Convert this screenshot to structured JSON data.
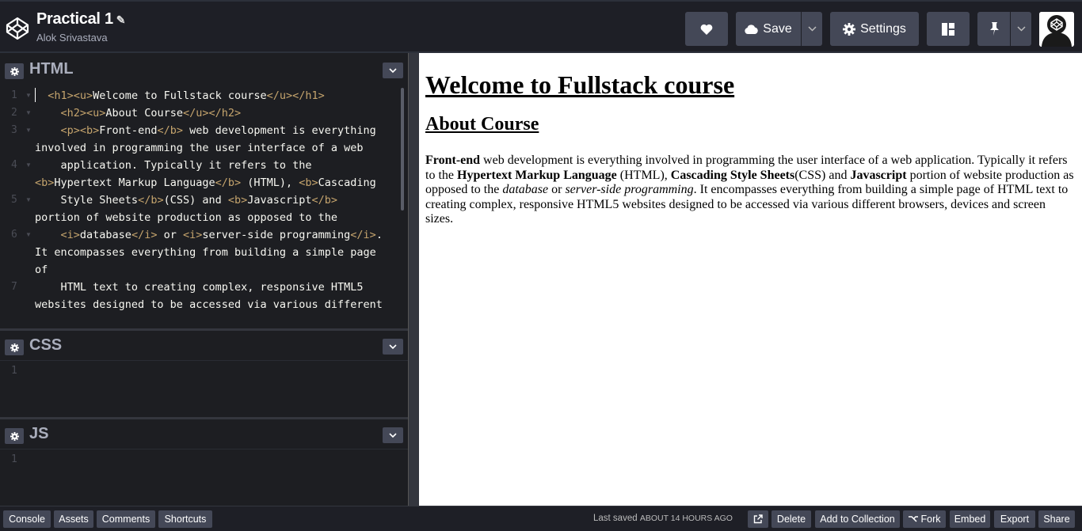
{
  "header": {
    "title": "Practical 1",
    "author": "Alok Srivastava",
    "save_label": "Save",
    "settings_label": "Settings"
  },
  "panels": {
    "html": {
      "title": "HTML",
      "line_numbers": [
        "1",
        "2",
        "3",
        "4",
        "5",
        "6",
        "7"
      ]
    },
    "css": {
      "title": "CSS",
      "line_numbers": [
        "1"
      ]
    },
    "js": {
      "title": "JS",
      "line_numbers": [
        "1"
      ]
    }
  },
  "preview": {
    "heading1": "Welcome to Fullstack course",
    "heading2": "About Course",
    "para": {
      "b1": "Front-end",
      "t1": " web development is everything involved in programming the user interface of a web application. Typically it refers to the ",
      "b2": "Hypertext Markup Language",
      "t2": " (HTML), ",
      "b3": "Cascading Style Sheets",
      "t3": "(CSS) and ",
      "b4": "Javascript",
      "t4": " portion of website production as opposed to the ",
      "i1": "database",
      "t5": " or ",
      "i2": "server-side programming",
      "t6": ". It encompasses everything from building a simple page of HTML text to creating complex, responsive HTML5 websites designed to be accessed via various different browsers, devices and screen sizes."
    }
  },
  "code": {
    "l1a": "<h1><u>",
    "l1b": "Welcome to Fullstack course",
    "l1c": "</u></h1>",
    "l2a": "<h2><u>",
    "l2b": "About Course",
    "l2c": "</u></h2>",
    "l3a": "<p><b>",
    "l3b": "Front-end",
    "l3c": "</b>",
    "l3d": " web development is everything involved in programming the user interface of a web",
    "l4a": "application. Typically it refers to the ",
    "l4b": "<b>",
    "l4c": "Hypertext Markup Language",
    "l4d": "</b>",
    "l4e": " (HTML), ",
    "l4f": "<b>",
    "l4g": "Cascading",
    "l5a": "Style Sheets",
    "l5b": "</b>",
    "l5c": "(CSS) and ",
    "l5d": "<b>",
    "l5e": "Javascript",
    "l5f": "</b>",
    "l5g": " portion of website production as opposed to the",
    "l6a": "<i>",
    "l6b": "database",
    "l6c": "</i>",
    "l6d": " or ",
    "l6e": "<i>",
    "l6f": "server-side programming",
    "l6g": "</i>",
    "l6h": ". It encompasses everything from building a simple page of",
    "l7a": "HTML text to creating complex, responsive HTML5 websites designed to be accessed via various different"
  },
  "footer": {
    "console": "Console",
    "assets": "Assets",
    "comments": "Comments",
    "shortcuts": "Shortcuts",
    "saved_prefix": "Last saved",
    "saved_time": "ABOUT 14 HOURS AGO",
    "delete": "Delete",
    "add_collection": "Add to Collection",
    "fork": "Fork",
    "embed": "Embed",
    "export": "Export",
    "share": "Share"
  },
  "colors": {
    "tag": "#c5a46d",
    "toolbar": "#444857",
    "bg": "#1e1f26"
  }
}
